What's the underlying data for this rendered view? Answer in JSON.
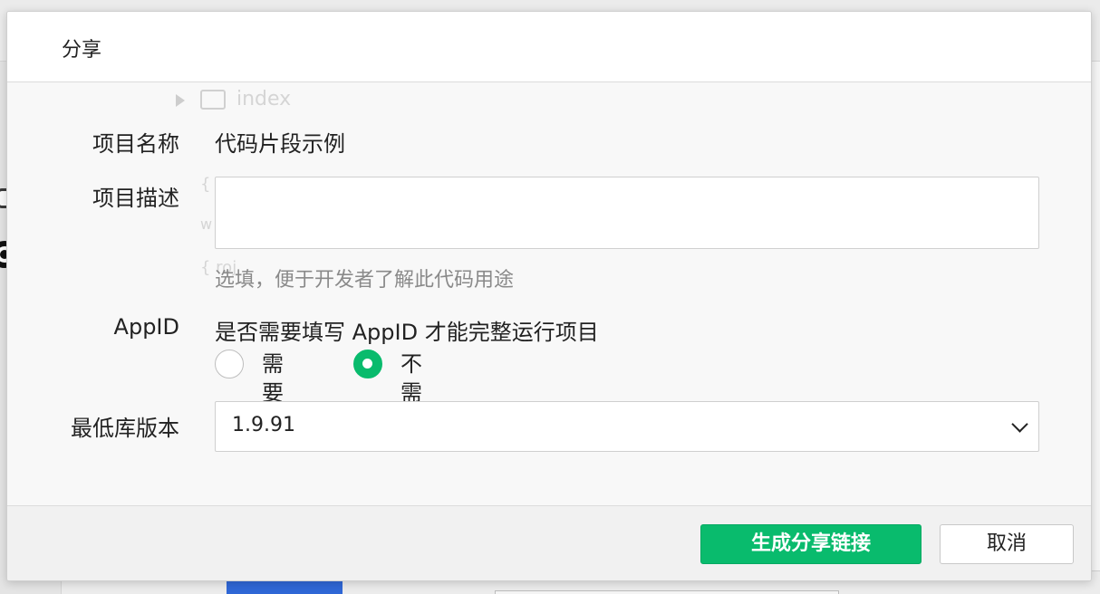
{
  "dialog": {
    "title": "分享"
  },
  "background": {
    "folder_name": "index",
    "ghost_lines": [
      "{",
      "w",
      "{ roj"
    ]
  },
  "form": {
    "project_name_label": "项目名称",
    "project_name_value": "代码片段示例",
    "description_label": "项目描述",
    "description_value": "",
    "description_hint": "选填，便于开发者了解此代码用途",
    "appid_label": "AppID",
    "appid_question": "是否需要填写 AppID 才能完整运行项目",
    "appid_options": [
      {
        "label": "需要",
        "selected": false
      },
      {
        "label": "不需要",
        "selected": true
      }
    ],
    "min_version_label": "最低库版本",
    "min_version_value": "1.9.91"
  },
  "footer": {
    "generate_label": "生成分享链接",
    "cancel_label": "取消"
  },
  "colors": {
    "primary": "#09bb6d",
    "accent_tab": "#2f67d6"
  }
}
